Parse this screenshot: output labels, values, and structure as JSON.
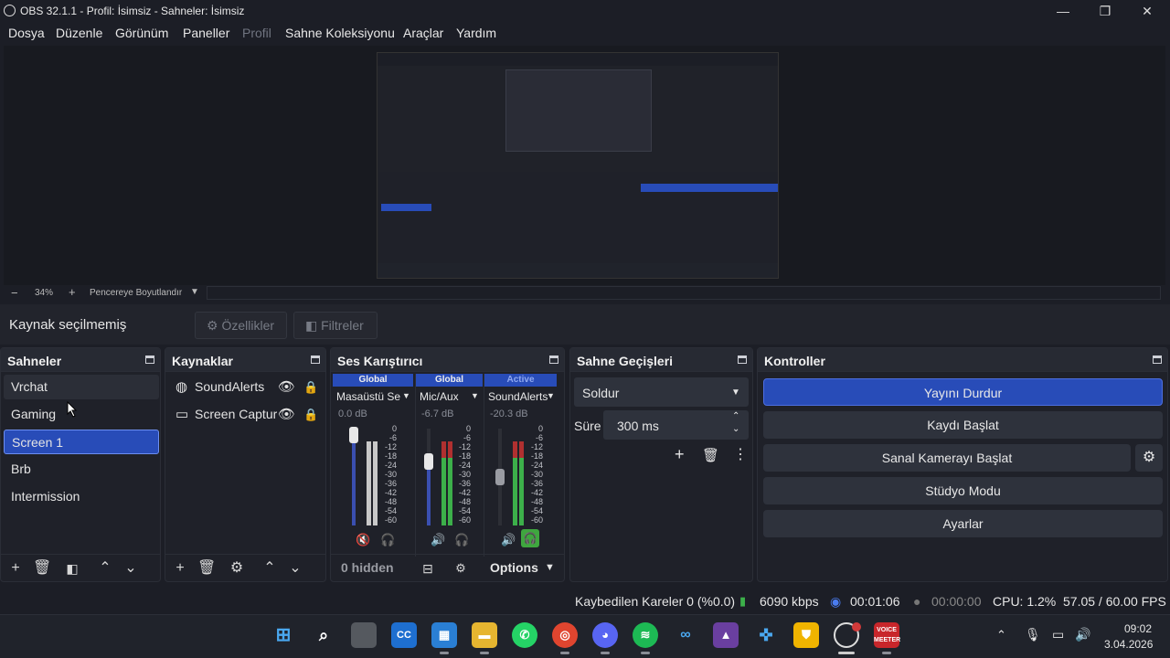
{
  "window": {
    "title": "OBS 32.1.1 - Profil: İsimsiz - Sahneler: İsimsiz",
    "minimize": "—",
    "maximize": "❐",
    "close": "✕"
  },
  "menu": [
    "Dosya",
    "Düzenle",
    "Görünüm",
    "Paneller",
    "Profil",
    "Sahne Koleksiyonu",
    "Araçlar",
    "Yardım"
  ],
  "zoom": {
    "minus": "−",
    "value": "34%",
    "plus": "+",
    "mode": "Pencereye Boyutlandır"
  },
  "source_bar": {
    "label": "Kaynak seçilmemiş",
    "properties": "Özellikler",
    "filters": "Filtreler"
  },
  "scenes": {
    "title": "Sahneler",
    "items": [
      "Vrchat",
      "Gaming",
      "Screen 1",
      "Brb",
      "Intermission"
    ],
    "selected": "Screen 1"
  },
  "sources": {
    "title": "Kaynaklar",
    "items": [
      "SoundAlerts",
      "Screen Captur"
    ]
  },
  "mixer": {
    "title": "Ses Karıştırıcı",
    "channels": [
      {
        "status": "Global",
        "name": "Masaüstü Ses",
        "db": "0.0 dB",
        "level": 1.0,
        "muted": true
      },
      {
        "status": "Global",
        "name": "Mic/Aux",
        "db": "-6.7 dB",
        "level": 0.72,
        "muted": false
      },
      {
        "status": "Active",
        "name": "SoundAlerts",
        "db": "-20.3 dB",
        "level": 0.45,
        "muted": false
      }
    ],
    "scale": [
      "0",
      "-6",
      "-12",
      "-18",
      "-24",
      "-30",
      "-36",
      "-42",
      "-48",
      "-54",
      "-60"
    ],
    "hidden": "0 hidden",
    "options": "Options"
  },
  "transitions": {
    "title": "Sahne Geçişleri",
    "selected": "Soldur",
    "duration_label": "Süre",
    "duration": "300 ms"
  },
  "controls": {
    "title": "Kontroller",
    "buttons": [
      "Yayını Durdur",
      "Kaydı Başlat",
      "Sanal Kamerayı Başlat",
      "Stüdyo Modu",
      "Ayarlar"
    ]
  },
  "status": {
    "dropped": "Kaybedilen Kareler 0 (%0.0)",
    "bitrate": "6090 kbps",
    "stream_time": "00:01:06",
    "rec_time": "00:00:00",
    "cpu": "CPU: 1.2%",
    "fps": "57.05 / 60.00 FPS"
  },
  "taskbar": {
    "time": "09:02",
    "date": "3.04.2026",
    "voicemeeter": "VOICE MEETER"
  },
  "colors": {
    "accent": "#284cb8",
    "background": "#1c1e26",
    "dock": "#1f2129",
    "meter_green": "#3cb04a",
    "meter_red": "#b03030",
    "muted_red": "#d23a3a",
    "headphone_green": "#3fa63f"
  }
}
